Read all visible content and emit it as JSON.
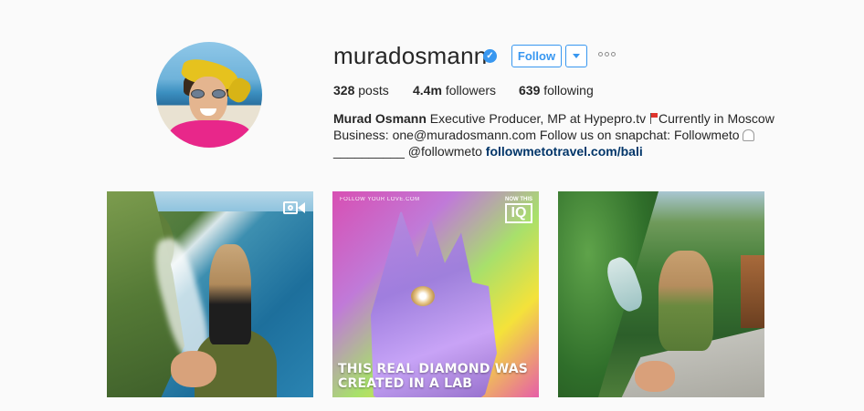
{
  "profile": {
    "username": "muradosmann",
    "follow_label": "Follow",
    "stats": {
      "posts_count": "328",
      "posts_label": "posts",
      "followers_count": "4.4m",
      "followers_label": "followers",
      "following_count": "639",
      "following_label": "following"
    },
    "bio": {
      "full_name": "Murad Osmann",
      "line1_text": " Executive Producer, MP at Hypepro.tv ",
      "line1_tail": "Currently in Moscow",
      "line2_text": "Business: one@muradosmann.com Follow us on snapchat: Followmeto",
      "line3_prefix": "__________ ",
      "mention": "@followmeto",
      "link": "followmetotravel.com/bali"
    }
  },
  "posts": [
    {
      "type": "video",
      "icon": "video-camera-icon"
    },
    {
      "type": "image",
      "small_tag": "FOLLOW YOUR LOVE.COM",
      "badge_top": "NOW THIS",
      "badge_big": "IQ",
      "caption": "This real diamond was created in a lab"
    },
    {
      "type": "image"
    }
  ],
  "colors": {
    "accent": "#3897f0",
    "text": "#262626",
    "link_dark": "#003569",
    "background": "#fafafa"
  },
  "icons": {
    "verified": "verified-badge-icon",
    "dropdown": "chevron-down-icon",
    "options": "more-options-icon",
    "flag": "red-flag-icon",
    "snapchat": "ghost-icon"
  }
}
